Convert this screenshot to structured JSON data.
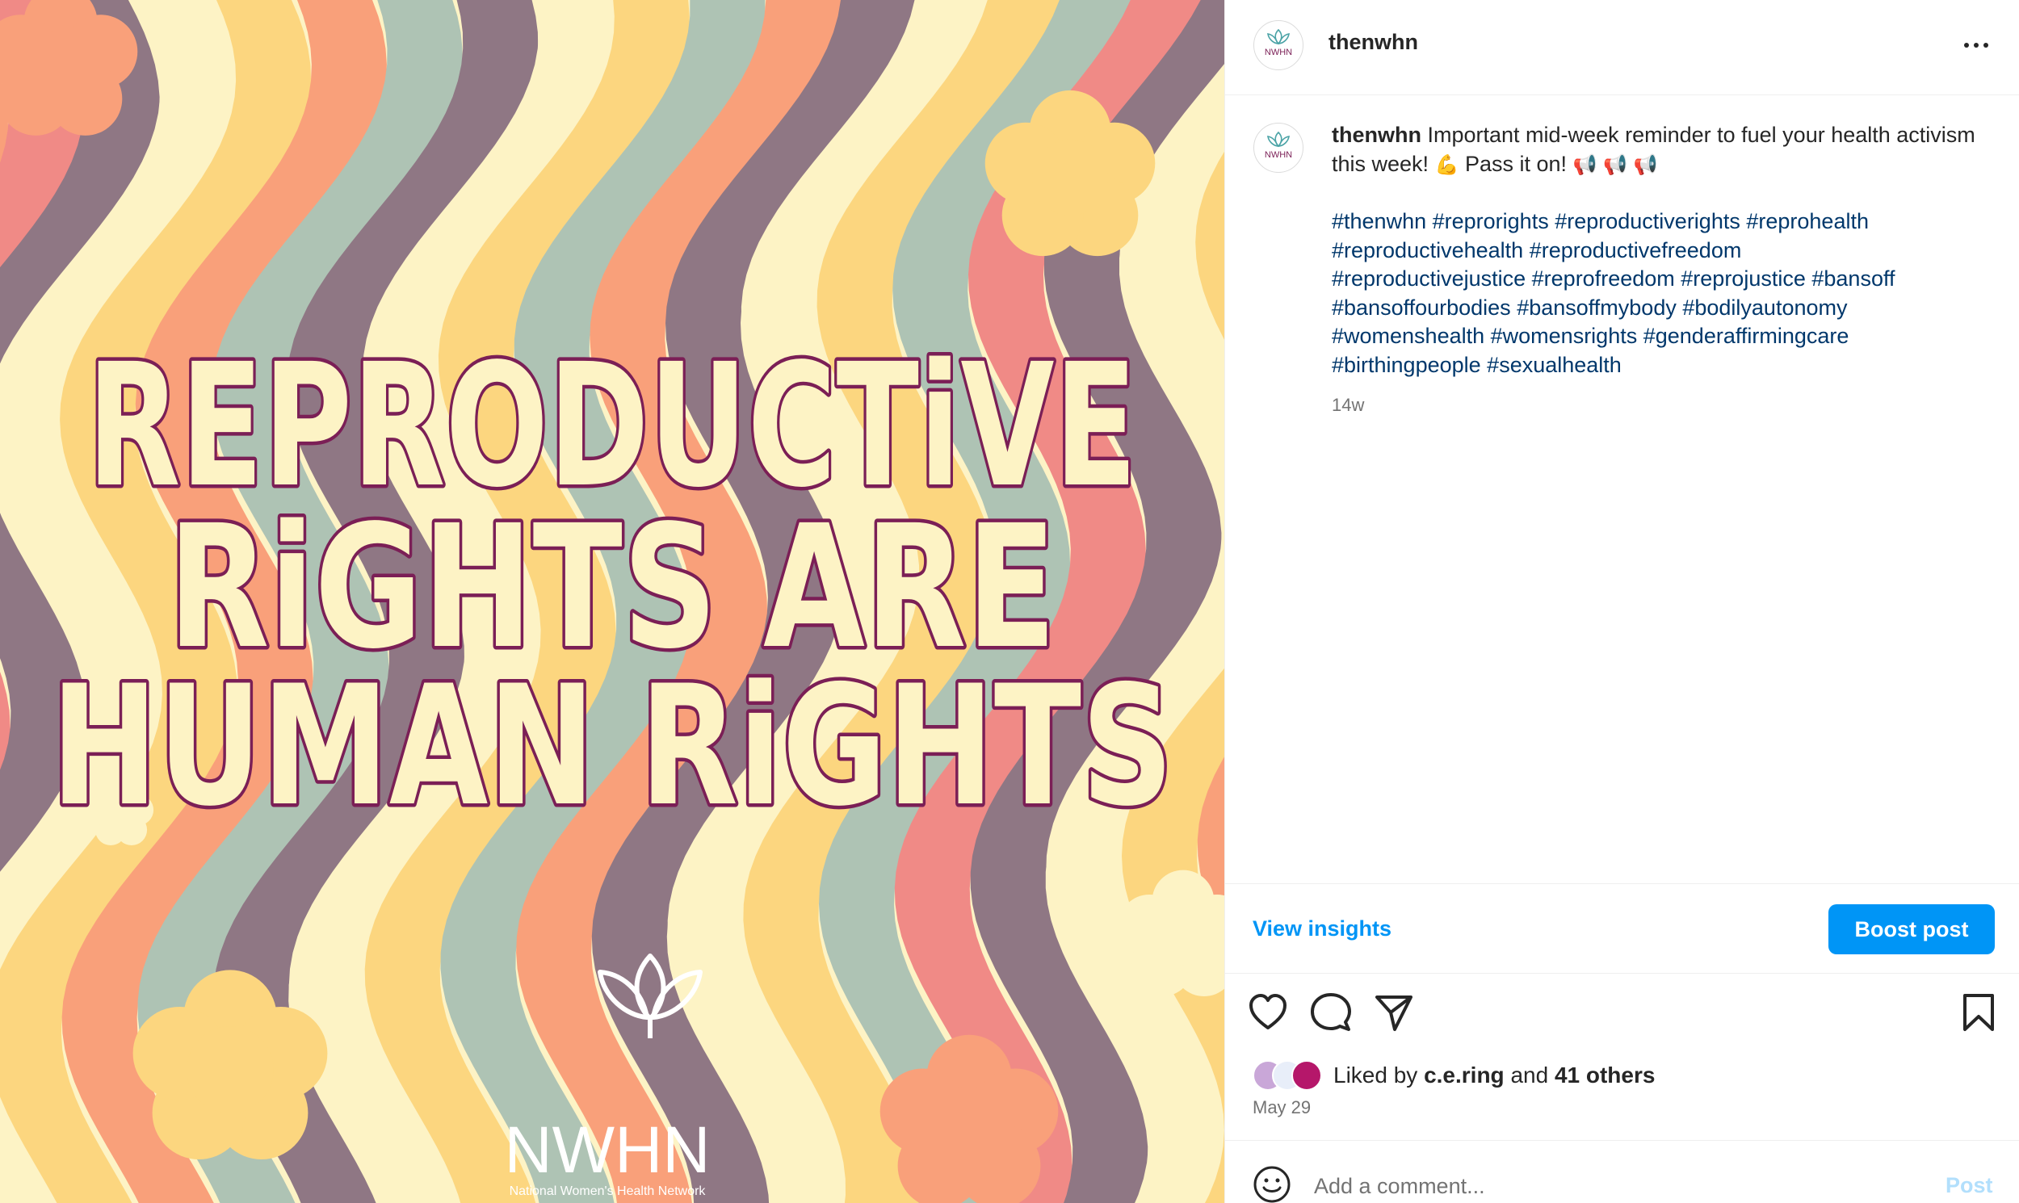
{
  "post": {
    "image": {
      "headline_lines": [
        "REPRODUCTiVE",
        "RiGHTS ARE",
        "HUMAN RiGHTS"
      ],
      "logo_text": "NWHN",
      "logo_subtext": "National Women's Health Network",
      "palette": {
        "pink": "#f08a86",
        "mauve": "#8f7784",
        "cream": "#fdf3c5",
        "yellow": "#fcd67f",
        "peach": "#f9a07a",
        "sage": "#aec3b4",
        "text_outline": "#7b1f56"
      }
    },
    "header": {
      "username": "thenwhn",
      "avatar_text": "NWHN",
      "more_icon": "more-horizontal-icon"
    },
    "caption": {
      "username": "thenwhn",
      "text": "Important mid-week reminder to fuel your health activism this week!",
      "emoji_muscle": "💪",
      "text_pass": "Pass it on!",
      "emoji_megaphones": "📢 📢 📢",
      "hashtags": [
        "#thenwhn",
        "#reprorights",
        "#reproductiverights",
        "#reprohealth",
        "#reproductivehealth",
        "#reproductivefreedom",
        "#reproductivejustice",
        "#reprofreedom",
        "#reprojustice",
        "#bansoff",
        "#bansoffourbodies",
        "#bansoffmybody",
        "#bodilyautonomy",
        "#womenshealth",
        "#womensrights",
        "#genderaffirmingcare",
        "#birthingpeople",
        "#sexualhealth"
      ],
      "time_ago": "14w"
    },
    "insights": {
      "view_insights_label": "View insights",
      "boost_label": "Boost post"
    },
    "actions": {
      "like_icon": "heart-icon",
      "comment_icon": "comment-icon",
      "share_icon": "send-icon",
      "save_icon": "bookmark-icon"
    },
    "likes": {
      "prefix": "Liked by",
      "user": "c.e.ring",
      "and": "and",
      "others": "41 others"
    },
    "date": "May 29",
    "comment": {
      "placeholder": "Add a comment...",
      "post_label": "Post"
    },
    "colors": {
      "accent": "#0095f6",
      "hashtag": "#00376b",
      "muted": "#737373",
      "post_disabled": "#b2dffc"
    }
  }
}
